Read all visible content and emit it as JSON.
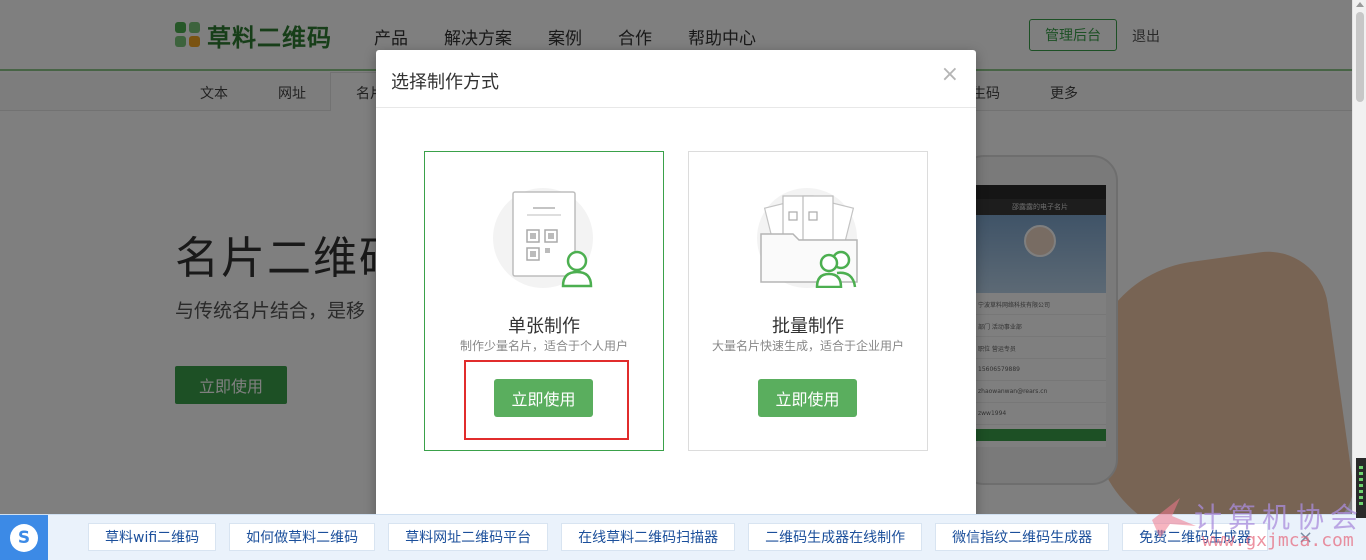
{
  "topnav": {
    "logo_text": "草料二维码",
    "items": [
      "产品",
      "解决方案",
      "案例",
      "合作",
      "帮助中心"
    ],
    "admin_button": "管理后台",
    "logout": "退出"
  },
  "subnav": {
    "items": [
      "文本",
      "网址",
      "名片",
      "生码",
      "更多"
    ]
  },
  "hero": {
    "title": "名片二维码",
    "subtitle": "与传统名片结合，是移",
    "button": "立即使用"
  },
  "phone": {
    "header": "邵露露的电子名片",
    "rows": [
      "宁波草料网络科技有限公司",
      "部门  活动事业部",
      "职位  营运专员",
      "15606579889",
      "zhaowanwan@rears.cn",
      "zww1994"
    ]
  },
  "modal": {
    "title": "选择制作方式",
    "close": "×",
    "options": [
      {
        "title": "单张制作",
        "desc": "制作少量名片，适合于个人用户",
        "button": "立即使用"
      },
      {
        "title": "批量制作",
        "desc": "大量名片快速生成，适合于企业用户",
        "button": "立即使用"
      }
    ]
  },
  "bottombar": {
    "logo": "S",
    "chips": [
      "草料wifi二维码",
      "如何做草料二维码",
      "草料网址二维码平台",
      "在线草料二维码扫描器",
      "二维码生成器在线制作",
      "微信指纹二维码生成器",
      "免费二维码生成器"
    ],
    "close": "×"
  },
  "watermark": {
    "line1": "计算机协会",
    "line2": "www.gxjmca.com"
  },
  "colors": {
    "brand_green": "#3aa14a",
    "button_green": "#5aae5e",
    "highlight_red": "#e12c2c",
    "bar_blue": "#3c8ae6"
  }
}
